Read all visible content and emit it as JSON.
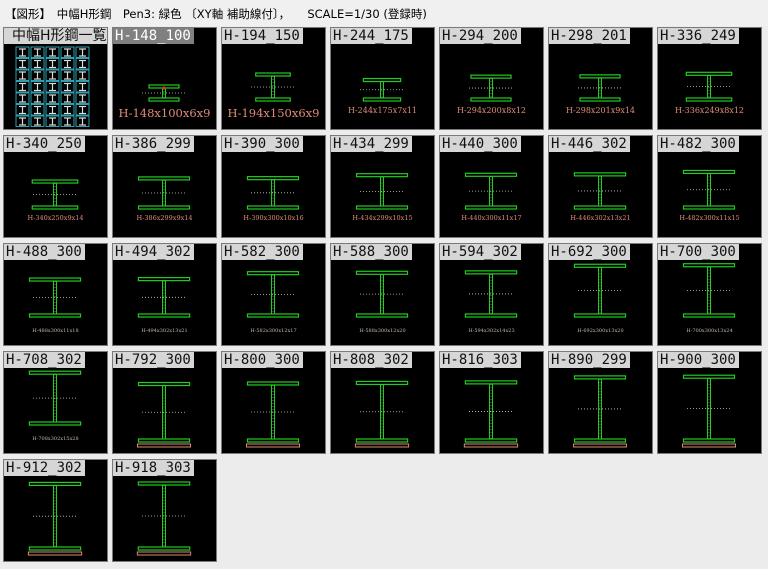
{
  "header": {
    "text": "【図形】　中幅H形鋼　Pen3: 緑色 〔XY軸 補助線付〕，　　SCALE=1/30 (登録時)"
  },
  "colors": {
    "tile_bg": "#000000",
    "section_line": "#22cc22",
    "dotted_guide": "#cccccc",
    "dims_text": "#e08a78",
    "label_bg": "#d6d6d6",
    "label_selected_bg": "#808080"
  },
  "tiles": [
    {
      "label": "中幅H形鋼一覧",
      "dims": "",
      "kind": "overview"
    },
    {
      "label": "H-148_100",
      "dims": "H-148x100x6x9",
      "kind": "section",
      "selected": true
    },
    {
      "label": "H-194_150",
      "dims": "H-194x150x6x9",
      "kind": "section"
    },
    {
      "label": "H-244_175",
      "dims": "H-244x175x7x11",
      "kind": "section"
    },
    {
      "label": "H-294_200",
      "dims": "H-294x200x8x12",
      "kind": "section"
    },
    {
      "label": "H-298_201",
      "dims": "H-298x201x9x14",
      "kind": "section"
    },
    {
      "label": "H-336_249",
      "dims": "H-336x249x8x12",
      "kind": "section"
    },
    {
      "label": "H-340_250",
      "dims": "H-340x250x9x14",
      "kind": "section"
    },
    {
      "label": "H-386_299",
      "dims": "H-386x299x9x14",
      "kind": "section"
    },
    {
      "label": "H-390_300",
      "dims": "H-390x300x10x16",
      "kind": "section"
    },
    {
      "label": "H-434_299",
      "dims": "H-434x299x10x15",
      "kind": "section"
    },
    {
      "label": "H-440_300",
      "dims": "H-440x300x11x17",
      "kind": "section"
    },
    {
      "label": "H-446_302",
      "dims": "H-446x302x13x21",
      "kind": "section"
    },
    {
      "label": "H-482_300",
      "dims": "H-482x300x11x15",
      "kind": "section"
    },
    {
      "label": "H-488_300",
      "dims": "H-488x300x11x18",
      "kind": "section"
    },
    {
      "label": "H-494_302",
      "dims": "H-494x302x13x21",
      "kind": "section"
    },
    {
      "label": "H-582_300",
      "dims": "H-582x300x12x17",
      "kind": "section"
    },
    {
      "label": "H-588_300",
      "dims": "H-588x300x12x20",
      "kind": "section"
    },
    {
      "label": "H-594_302",
      "dims": "H-594x302x14x23",
      "kind": "section"
    },
    {
      "label": "H-692_300",
      "dims": "H-692x300x13x20",
      "kind": "section"
    },
    {
      "label": "H-700_300",
      "dims": "H-700x300x13x24",
      "kind": "section"
    },
    {
      "label": "H-708_302",
      "dims": "H-708x302x15x28",
      "kind": "section"
    },
    {
      "label": "H-792_300",
      "dims": "",
      "kind": "section"
    },
    {
      "label": "H-800_300",
      "dims": "",
      "kind": "section"
    },
    {
      "label": "H-808_302",
      "dims": "",
      "kind": "section"
    },
    {
      "label": "H-816_303",
      "dims": "",
      "kind": "section"
    },
    {
      "label": "H-890_299",
      "dims": "",
      "kind": "section"
    },
    {
      "label": "H-900_300",
      "dims": "",
      "kind": "section"
    },
    {
      "label": "H-912_302",
      "dims": "",
      "kind": "section"
    },
    {
      "label": "H-918_303",
      "dims": "",
      "kind": "section"
    }
  ]
}
